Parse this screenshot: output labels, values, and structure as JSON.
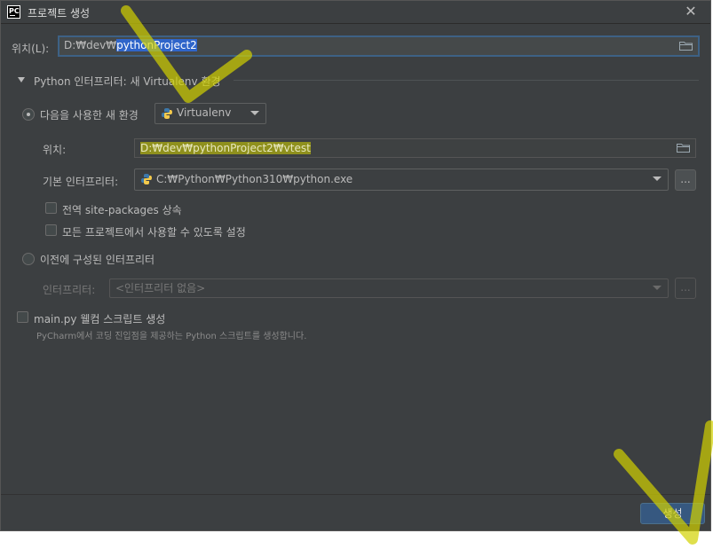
{
  "window": {
    "title": "프로젝트 생성",
    "app_icon_text": "PC"
  },
  "location": {
    "label": "위치(L):",
    "value_prefix": "D:₩dev₩",
    "value_selected": "pythonProject2"
  },
  "section": {
    "title": "Python 인터프리터: 새 Virtualenv 환경"
  },
  "new_env": {
    "radio_label": "다음을 사용한 새 환경",
    "env_type": "Virtualenv",
    "location_label": "위치:",
    "location_value": "D:₩dev₩pythonProject2₩vtest",
    "base_interpreter_label": "기본 인터프리터:",
    "base_interpreter_value": "C:₩Python₩Python310₩python.exe",
    "browse_label": "...",
    "inherit_label": "전역 site-packages 상속",
    "make_available_label": "모든 프로젝트에서 사용할 수 있도록 설정"
  },
  "existing": {
    "radio_label": "이전에 구성된 인터프리터",
    "interpreter_label": "인터프리터:",
    "interpreter_value": "<인터프리터 없음>",
    "browse_label": "..."
  },
  "welcome": {
    "checkbox_label": "main.py 웰컴 스크립트 생성",
    "hint": "PyCharm에서 코딩 진입점을 제공하는 Python 스크립트를 생성합니다."
  },
  "footer": {
    "create_label": "생성"
  },
  "colors": {
    "background": "#3c3f41",
    "selection": "#2f65ca",
    "primary_button": "#365880",
    "annotation": "#d2d200"
  },
  "icons": {
    "app": "pycharm-icon",
    "close": "close-icon",
    "folder": "folder-icon",
    "python": "python-icon",
    "expand": "triangle-down-icon"
  }
}
